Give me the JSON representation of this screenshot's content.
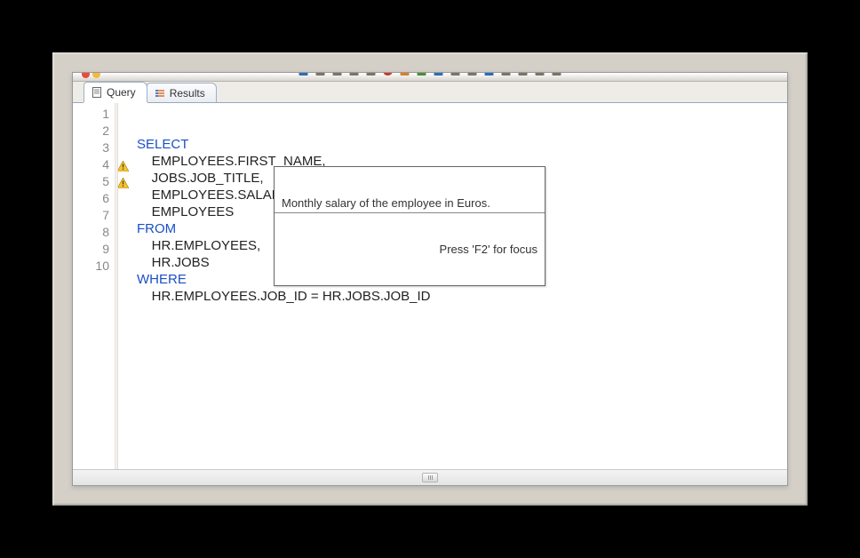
{
  "tabs": {
    "query": "Query",
    "results": "Results"
  },
  "editor": {
    "lines": [
      {
        "n": 1,
        "warn": false,
        "type": "kw",
        "text": "SELECT",
        "indent": 0
      },
      {
        "n": 2,
        "warn": false,
        "type": "code",
        "text": "EMPLOYEES.FIRST_NAME,",
        "indent": 1
      },
      {
        "n": 3,
        "warn": false,
        "type": "code",
        "text": "JOBS.JOB_TITLE,",
        "indent": 1
      },
      {
        "n": 4,
        "warn": true,
        "type": "code",
        "text": "EMPLOYEES.SALARY,",
        "indent": 1
      },
      {
        "n": 5,
        "warn": true,
        "type": "code",
        "text": "EMPLOYEES",
        "indent": 1
      },
      {
        "n": 6,
        "warn": false,
        "type": "kw",
        "text": "FROM",
        "indent": 0
      },
      {
        "n": 7,
        "warn": false,
        "type": "code",
        "text": "HR.EMPLOYEES,",
        "indent": 1
      },
      {
        "n": 8,
        "warn": false,
        "type": "code",
        "text": "HR.JOBS",
        "indent": 1
      },
      {
        "n": 9,
        "warn": false,
        "type": "kw",
        "text": "WHERE",
        "indent": 0
      },
      {
        "n": 10,
        "warn": false,
        "type": "code",
        "text": "HR.EMPLOYEES.JOB_ID = HR.JOBS.JOB_ID",
        "indent": 1
      }
    ]
  },
  "tooltip": {
    "message": "Monthly salary of the employee in Euros.",
    "hint": "Press 'F2' for focus"
  }
}
